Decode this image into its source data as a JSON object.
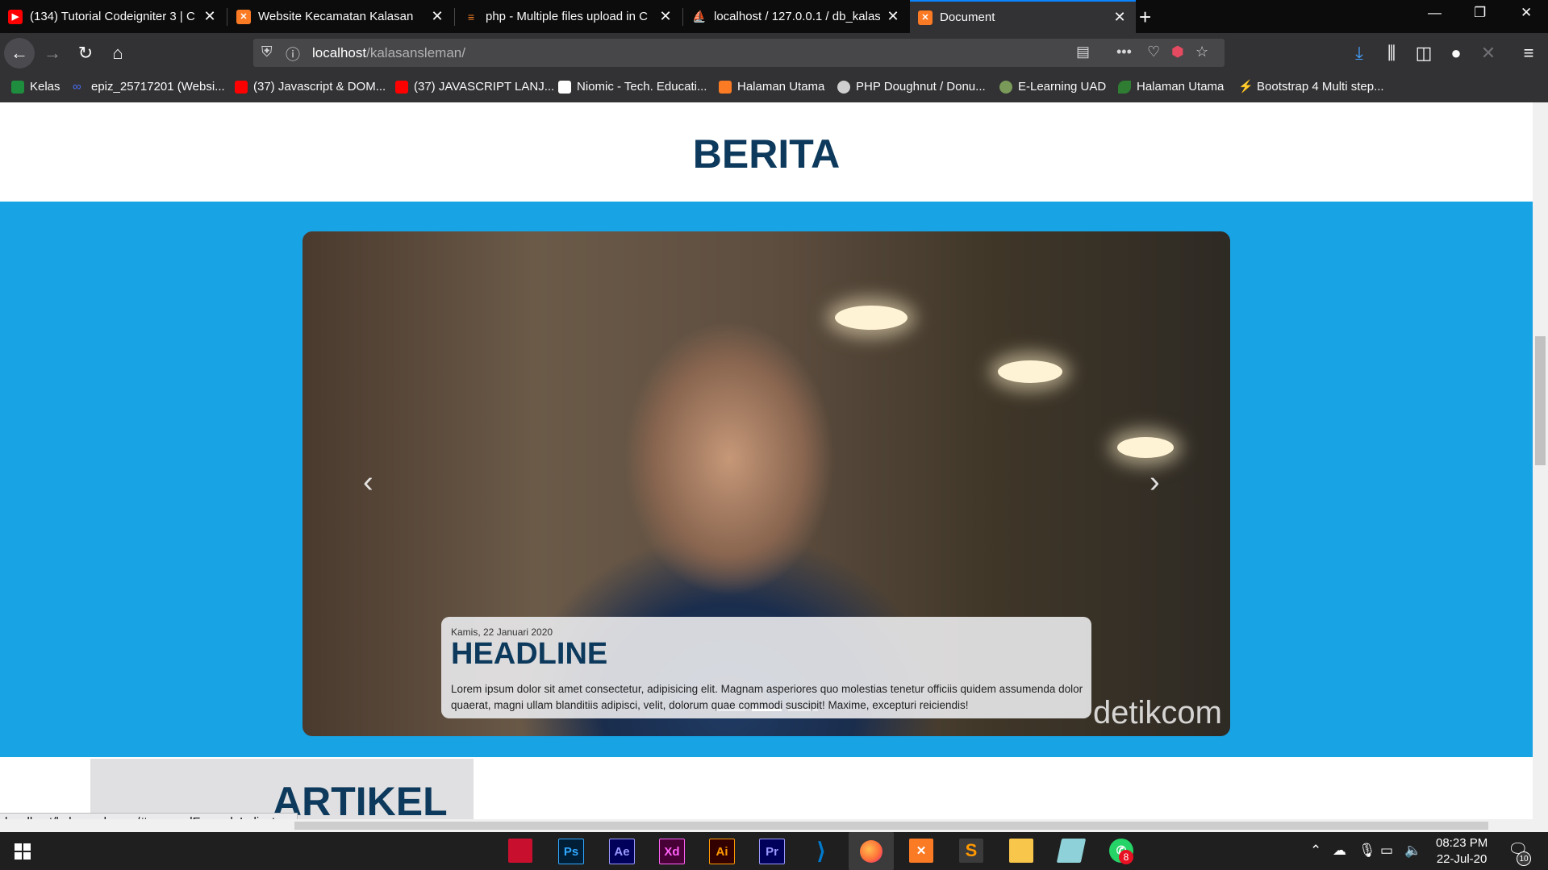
{
  "browser": {
    "tabs": [
      {
        "label": "(134) Tutorial Codeigniter 3 | C",
        "favicon": "youtube-icon",
        "color": "#ff0000"
      },
      {
        "label": "Website Kecamatan Kalasan",
        "favicon": "xampp-icon",
        "color": "#fb7a24"
      },
      {
        "label": "php - Multiple files upload in C",
        "favicon": "stackoverflow-icon",
        "color": "#f48024"
      },
      {
        "label": "localhost / 127.0.0.1 / db_kalas",
        "favicon": "phpmyadmin-icon",
        "color": "#f9a11b"
      },
      {
        "label": "Document",
        "favicon": "xampp-icon",
        "color": "#fb7a24",
        "active": true
      }
    ],
    "url_host": "localhost",
    "url_path": "/kalasansleman/",
    "bookmarks": [
      {
        "label": "Kelas",
        "icon": "classroom-icon",
        "color": "#1e8e3e"
      },
      {
        "label": "epiz_25717201 (Websi...",
        "icon": "infinity-icon",
        "color": "#4a6cf7"
      },
      {
        "label": "(37) Javascript & DOM...",
        "icon": "youtube-icon",
        "color": "#ff0000"
      },
      {
        "label": "(37) JAVASCRIPT LANJ...",
        "icon": "youtube-icon",
        "color": "#ff0000"
      },
      {
        "label": "Niomic - Tech. Educati...",
        "icon": "niomic-icon",
        "color": "#ffffff"
      },
      {
        "label": "Halaman Utama",
        "icon": "xampp-icon",
        "color": "#fb7a24"
      },
      {
        "label": "PHP Doughnut / Donu...",
        "icon": "globe-icon",
        "color": "#cfcfcf"
      },
      {
        "label": "E-Learning UAD",
        "icon": "uad-icon",
        "color": "#7a9a5a"
      },
      {
        "label": "Halaman Utama",
        "icon": "leaf-icon",
        "color": "#2e7d32"
      },
      {
        "label": "Bootstrap 4 Multi step...",
        "icon": "bolt-icon",
        "color": "#3d8bfd"
      }
    ]
  },
  "page": {
    "heading": "BERITA",
    "carousel": {
      "date": "Kamis, 22 Januari 2020",
      "title": "HEADLINE",
      "text": "Lorem ipsum dolor sit amet consectetur, adipisicing elit. Magnam asperiores quo molestias tenetur officiis quidem assumenda dolor quaerat, magni ullam blanditiis adipisci, velit, dolorum quae commodi suscipit! Maxime, excepturi reiciendis!",
      "watermark": "detikcom",
      "indicator_count": 3,
      "active_indicator": 2
    },
    "section2": "ARTIKEL",
    "status_url": "localhost/kalasansleman/#carouselExampleIndicators"
  },
  "taskbar": {
    "apps": [
      {
        "name": "red-app-icon",
        "label": "",
        "color": "#c8102e"
      },
      {
        "name": "photoshop-icon",
        "label": "Ps",
        "color": "#31a8ff"
      },
      {
        "name": "after-effects-icon",
        "label": "Ae",
        "color": "#9999ff"
      },
      {
        "name": "xd-icon",
        "label": "Xd",
        "color": "#ff61f6"
      },
      {
        "name": "illustrator-icon",
        "label": "Ai",
        "color": "#ff9a00"
      },
      {
        "name": "premiere-icon",
        "label": "Pr",
        "color": "#9999ff"
      },
      {
        "name": "vscode-icon",
        "label": "",
        "color": "#007acc"
      },
      {
        "name": "firefox-icon",
        "label": "",
        "color": "#ff7139",
        "active": true
      },
      {
        "name": "xampp-icon",
        "label": "",
        "color": "#fb7a24"
      },
      {
        "name": "sublime-icon",
        "label": "",
        "color": "#ff9800"
      },
      {
        "name": "file-explorer-icon",
        "label": "",
        "color": "#f7c64a"
      },
      {
        "name": "notes-icon",
        "label": "",
        "color": "#8fd1d8"
      },
      {
        "name": "whatsapp-icon",
        "label": "",
        "color": "#25d366",
        "badge": "8"
      }
    ],
    "time": "08:23 PM",
    "date": "22-Jul-20",
    "notification_count": "10"
  }
}
